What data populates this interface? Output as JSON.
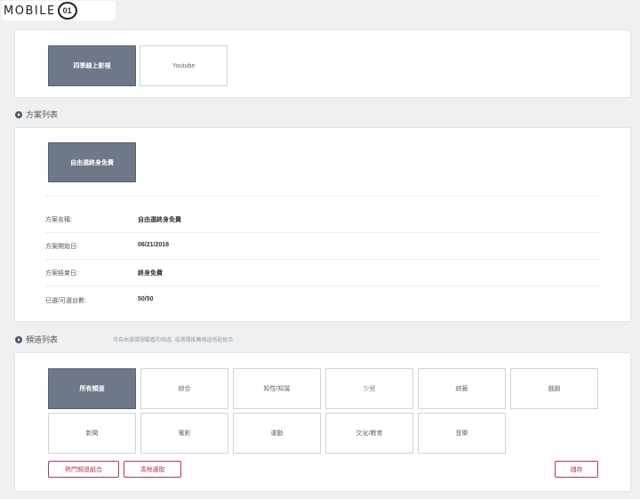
{
  "logo": {
    "text": "MOBILE",
    "badge": "01"
  },
  "sections": {
    "platform": {
      "tiles": [
        {
          "label": "四季線上影視",
          "active": true
        },
        {
          "label": "Youtube",
          "active": false
        }
      ]
    },
    "plan": {
      "title": "方案列表",
      "tile": {
        "label": "自由選終身免費",
        "active": true
      },
      "info": [
        {
          "label": "方案名稱:",
          "value": "自由選終身免費"
        },
        {
          "label": "方案開始日:",
          "value": "06/21/2018"
        },
        {
          "label": "方案結束日:",
          "value": "終身免費"
        },
        {
          "label": "已選/可選台數:",
          "value": "50/50"
        }
      ]
    },
    "channels": {
      "title": "頻道列表",
      "hint": "可自由選擇想觀看的頻道, 或選擇推薦頻道搭配組合",
      "tiles": [
        {
          "label": "所有頻道",
          "active": true
        },
        {
          "label": "綜合",
          "active": false
        },
        {
          "label": "知性/知識",
          "active": false
        },
        {
          "label": "少兒",
          "active": false
        },
        {
          "label": "綜藝",
          "active": false
        },
        {
          "label": "戲劇",
          "active": false
        },
        {
          "label": "新聞",
          "active": false
        },
        {
          "label": "電影",
          "active": false
        },
        {
          "label": "運動",
          "active": false
        },
        {
          "label": "文化/教育",
          "active": false
        },
        {
          "label": "音樂",
          "active": false
        }
      ],
      "buttons": {
        "popular": "熱門頻道組合",
        "clear": "清除選取",
        "save": "儲存"
      }
    }
  },
  "colors": {
    "active_tile": "#6e7888",
    "accent_red": "#b03a4c"
  }
}
